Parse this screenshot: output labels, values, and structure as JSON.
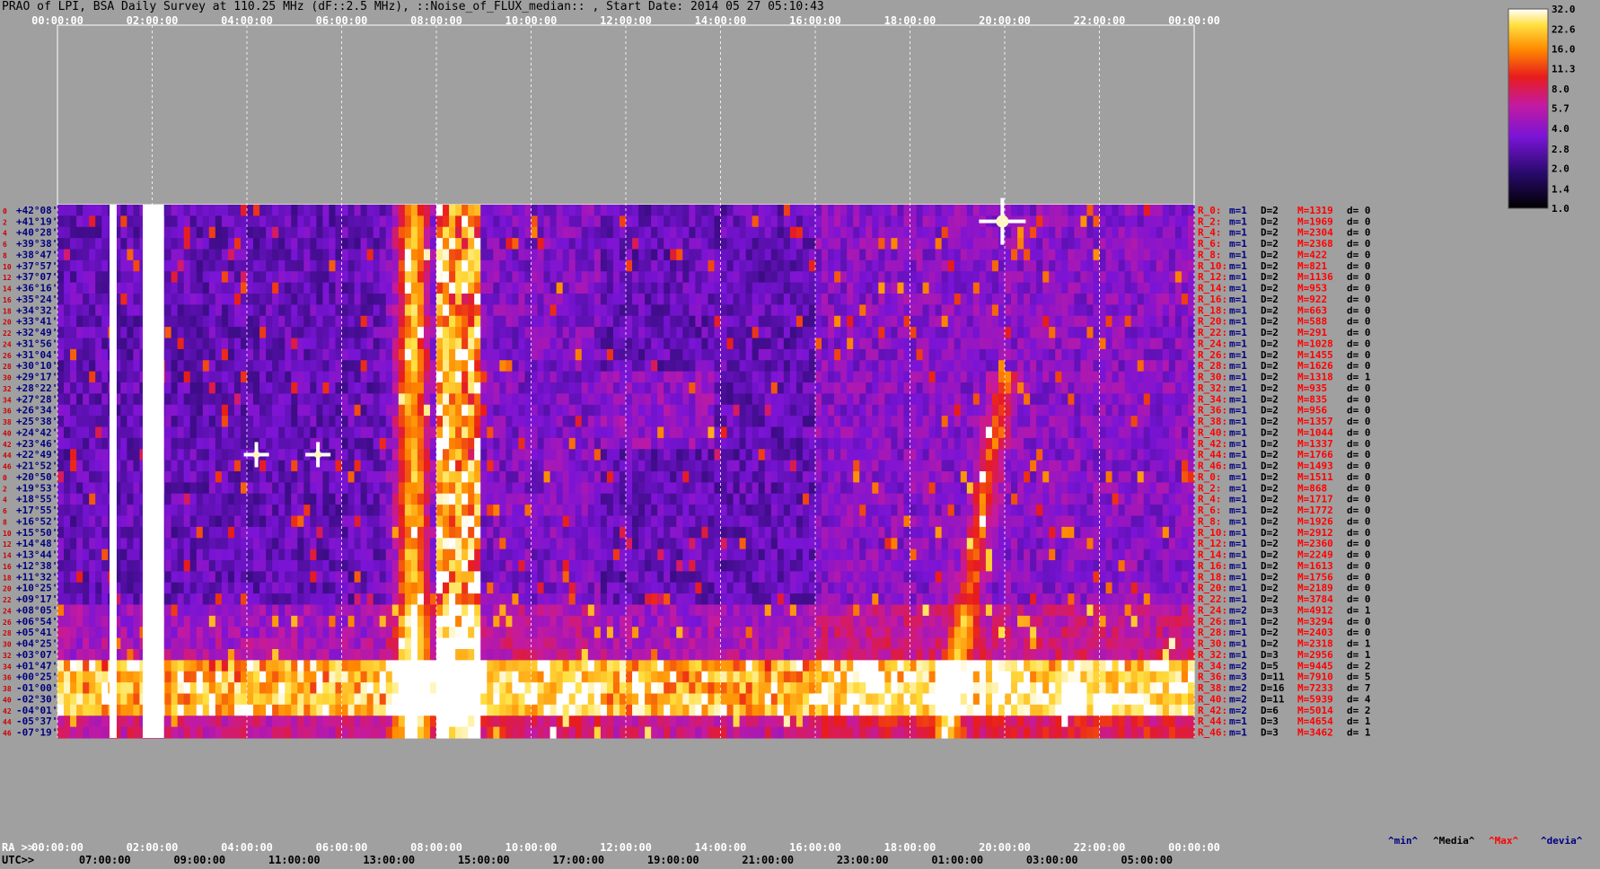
{
  "title": "PRAO of LPI, BSA Daily Survey at 110.25 MHz (dF::2.5 MHz), ::Noise_of_FLUX_median:: , Start Date: 2014 05 27 05:10:43",
  "chart_data": {
    "type": "heatmap",
    "top_axis_ticks": [
      "00:00:00",
      "02:00:00",
      "04:00:00",
      "06:00:00",
      "08:00:00",
      "10:00:00",
      "12:00:00",
      "14:00:00",
      "16:00:00",
      "18:00:00",
      "20:00:00",
      "22:00:00",
      "00:00:00"
    ],
    "ra_axis_label": "RA >>",
    "ra_ticks": [
      "00:00:00",
      "02:00:00",
      "04:00:00",
      "06:00:00",
      "08:00:00",
      "10:00:00",
      "12:00:00",
      "14:00:00",
      "16:00:00",
      "18:00:00",
      "20:00:00",
      "22:00:00",
      "00:00:00"
    ],
    "utc_axis_label": "UTC>>",
    "utc_ticks": [
      "07:00:00",
      "09:00:00",
      "11:00:00",
      "13:00:00",
      "15:00:00",
      "17:00:00",
      "19:00:00",
      "21:00:00",
      "23:00:00",
      "01:00:00",
      "03:00:00",
      "05:00:00"
    ],
    "row_numbers": [
      "0",
      "2",
      "4",
      "6",
      "8",
      "10",
      "12",
      "14",
      "16",
      "18",
      "20",
      "22",
      "24",
      "26",
      "28",
      "30",
      "32",
      "34",
      "36",
      "38",
      "40",
      "42",
      "44",
      "46",
      "0",
      "2",
      "4",
      "6",
      "8",
      "10",
      "12",
      "14",
      "16",
      "18",
      "20",
      "22",
      "24",
      "26",
      "28",
      "30",
      "32",
      "34",
      "36",
      "38",
      "40",
      "42",
      "44",
      "46"
    ],
    "dec_labels": [
      "+42°08'",
      "+41°19'",
      "+40°28'",
      "+39°38'",
      "+38°47'",
      "+37°57'",
      "+37°07'",
      "+36°16'",
      "+35°24'",
      "+34°32'",
      "+33°41'",
      "+32°49'",
      "+31°56'",
      "+31°04'",
      "+30°10'",
      "+29°17'",
      "+28°22'",
      "+27°28'",
      "+26°34'",
      "+25°38'",
      "+24°42'",
      "+23°46'",
      "+22°49'",
      "+21°52'",
      "+20°50'",
      "+19°53'",
      "+18°55'",
      "+17°55'",
      "+16°52'",
      "+15°50'",
      "+14°48'",
      "+13°44'",
      "+12°38'",
      "+11°32'",
      "+10°25'",
      "+09°17'",
      "+08°05'",
      "+06°54'",
      "+05°41'",
      "+04°25'",
      "+03°07'",
      "+01°47'",
      "+00°25'",
      "-01°00'",
      "-02°30'",
      "-04°01'",
      "-05°37'",
      "-07°19'"
    ],
    "rays": [
      {
        "ray": "R_0:",
        "m": "m=1",
        "d": "D=2",
        "max": "M=1319",
        "dev": "d= 0"
      },
      {
        "ray": "R_2:",
        "m": "m=1",
        "d": "D=2",
        "max": "M=1969",
        "dev": "d= 0"
      },
      {
        "ray": "R_4:",
        "m": "m=1",
        "d": "D=2",
        "max": "M=2304",
        "dev": "d= 0"
      },
      {
        "ray": "R_6:",
        "m": "m=1",
        "d": "D=2",
        "max": "M=2368",
        "dev": "d= 0"
      },
      {
        "ray": "R_8:",
        "m": "m=1",
        "d": "D=2",
        "max": "M=422",
        "dev": "d= 0"
      },
      {
        "ray": "R_10:",
        "m": "m=1",
        "d": "D=2",
        "max": "M=821",
        "dev": "d= 0"
      },
      {
        "ray": "R_12:",
        "m": "m=1",
        "d": "D=2",
        "max": "M=1136",
        "dev": "d= 0"
      },
      {
        "ray": "R_14:",
        "m": "m=1",
        "d": "D=2",
        "max": "M=953",
        "dev": "d= 0"
      },
      {
        "ray": "R_16:",
        "m": "m=1",
        "d": "D=2",
        "max": "M=922",
        "dev": "d= 0"
      },
      {
        "ray": "R_18:",
        "m": "m=1",
        "d": "D=2",
        "max": "M=663",
        "dev": "d= 0"
      },
      {
        "ray": "R_20:",
        "m": "m=1",
        "d": "D=2",
        "max": "M=588",
        "dev": "d= 0"
      },
      {
        "ray": "R_22:",
        "m": "m=1",
        "d": "D=2",
        "max": "M=291",
        "dev": "d= 0"
      },
      {
        "ray": "R_24:",
        "m": "m=1",
        "d": "D=2",
        "max": "M=1028",
        "dev": "d= 0"
      },
      {
        "ray": "R_26:",
        "m": "m=1",
        "d": "D=2",
        "max": "M=1455",
        "dev": "d= 0"
      },
      {
        "ray": "R_28:",
        "m": "m=1",
        "d": "D=2",
        "max": "M=1626",
        "dev": "d= 0"
      },
      {
        "ray": "R_30:",
        "m": "m=1",
        "d": "D=2",
        "max": "M=1318",
        "dev": "d= 1"
      },
      {
        "ray": "R_32:",
        "m": "m=1",
        "d": "D=2",
        "max": "M=935",
        "dev": "d= 0"
      },
      {
        "ray": "R_34:",
        "m": "m=1",
        "d": "D=2",
        "max": "M=835",
        "dev": "d= 0"
      },
      {
        "ray": "R_36:",
        "m": "m=1",
        "d": "D=2",
        "max": "M=956",
        "dev": "d= 0"
      },
      {
        "ray": "R_38:",
        "m": "m=1",
        "d": "D=2",
        "max": "M=1357",
        "dev": "d= 0"
      },
      {
        "ray": "R_40:",
        "m": "m=1",
        "d": "D=2",
        "max": "M=1044",
        "dev": "d= 0"
      },
      {
        "ray": "R_42:",
        "m": "m=1",
        "d": "D=2",
        "max": "M=1337",
        "dev": "d= 0"
      },
      {
        "ray": "R_44:",
        "m": "m=1",
        "d": "D=2",
        "max": "M=1766",
        "dev": "d= 0"
      },
      {
        "ray": "R_46:",
        "m": "m=1",
        "d": "D=2",
        "max": "M=1493",
        "dev": "d= 0"
      },
      {
        "ray": "R_0:",
        "m": "m=1",
        "d": "D=2",
        "max": "M=1511",
        "dev": "d= 0"
      },
      {
        "ray": "R_2:",
        "m": "m=1",
        "d": "D=2",
        "max": "M=868",
        "dev": "d= 0"
      },
      {
        "ray": "R_4:",
        "m": "m=1",
        "d": "D=2",
        "max": "M=1717",
        "dev": "d= 0"
      },
      {
        "ray": "R_6:",
        "m": "m=1",
        "d": "D=2",
        "max": "M=1772",
        "dev": "d= 0"
      },
      {
        "ray": "R_8:",
        "m": "m=1",
        "d": "D=2",
        "max": "M=1926",
        "dev": "d= 0"
      },
      {
        "ray": "R_10:",
        "m": "m=1",
        "d": "D=2",
        "max": "M=2912",
        "dev": "d= 0"
      },
      {
        "ray": "R_12:",
        "m": "m=1",
        "d": "D=2",
        "max": "M=2360",
        "dev": "d= 0"
      },
      {
        "ray": "R_14:",
        "m": "m=1",
        "d": "D=2",
        "max": "M=2249",
        "dev": "d= 0"
      },
      {
        "ray": "R_16:",
        "m": "m=1",
        "d": "D=2",
        "max": "M=1613",
        "dev": "d= 0"
      },
      {
        "ray": "R_18:",
        "m": "m=1",
        "d": "D=2",
        "max": "M=1756",
        "dev": "d= 0"
      },
      {
        "ray": "R_20:",
        "m": "m=1",
        "d": "D=2",
        "max": "M=2189",
        "dev": "d= 0"
      },
      {
        "ray": "R_22:",
        "m": "m=1",
        "d": "D=2",
        "max": "M=3784",
        "dev": "d= 0"
      },
      {
        "ray": "R_24:",
        "m": "m=2",
        "d": "D=3",
        "max": "M=4912",
        "dev": "d= 1"
      },
      {
        "ray": "R_26:",
        "m": "m=1",
        "d": "D=2",
        "max": "M=3294",
        "dev": "d= 0"
      },
      {
        "ray": "R_28:",
        "m": "m=1",
        "d": "D=2",
        "max": "M=2403",
        "dev": "d= 0"
      },
      {
        "ray": "R_30:",
        "m": "m=1",
        "d": "D=2",
        "max": "M=2318",
        "dev": "d= 1"
      },
      {
        "ray": "R_32:",
        "m": "m=1",
        "d": "D=3",
        "max": "M=2956",
        "dev": "d= 1"
      },
      {
        "ray": "R_34:",
        "m": "m=2",
        "d": "D=5",
        "max": "M=9445",
        "dev": "d= 2"
      },
      {
        "ray": "R_36:",
        "m": "m=3",
        "d": "D=11",
        "max": "M=7910",
        "dev": "d= 5"
      },
      {
        "ray": "R_38:",
        "m": "m=2",
        "d": "D=16",
        "max": "M=7233",
        "dev": "d= 7"
      },
      {
        "ray": "R_40:",
        "m": "m=2",
        "d": "D=11",
        "max": "M=5939",
        "dev": "d= 4"
      },
      {
        "ray": "R_42:",
        "m": "m=2",
        "d": "D=6",
        "max": "M=5014",
        "dev": "d= 2"
      },
      {
        "ray": "R_44:",
        "m": "m=1",
        "d": "D=3",
        "max": "M=4654",
        "dev": "d= 1"
      },
      {
        "ray": "R_46:",
        "m": "m=1",
        "d": "D=3",
        "max": "M=3462",
        "dev": "d= 1"
      }
    ],
    "stats_legend": [
      "^min^",
      "^Media^",
      "^Max^",
      "^devia^"
    ],
    "colorbar": {
      "ticks": [
        "32.0",
        "22.6",
        "16.0",
        "11.3",
        "8.0",
        "5.7",
        "4.0",
        "2.8",
        "2.0",
        "1.4",
        "1.0"
      ],
      "range": [
        1.0,
        32.0
      ],
      "scale": "log2"
    },
    "features": [
      {
        "name": "RFI white band",
        "ra_start_h": 1.1,
        "ra_end_h": 1.25,
        "dec_from": "+42°08'",
        "dec_to": "-07°19'"
      },
      {
        "name": "RFI white band",
        "ra_start_h": 1.8,
        "ra_end_h": 2.25,
        "dec_from": "+42°08'",
        "dec_to": "-07°19'"
      },
      {
        "name": "Galactic plane emission",
        "ra_start_h": 7.1,
        "ra_end_h": 8.95,
        "level": "high"
      },
      {
        "name": "Strong source",
        "ra_h": 19.95,
        "dec": "+41°19'"
      },
      {
        "name": "Source",
        "ra_h": 4.2,
        "dec": "+22°49'"
      },
      {
        "name": "Source",
        "ra_h": 5.5,
        "dec": "+22°49'"
      }
    ],
    "grid": true
  }
}
